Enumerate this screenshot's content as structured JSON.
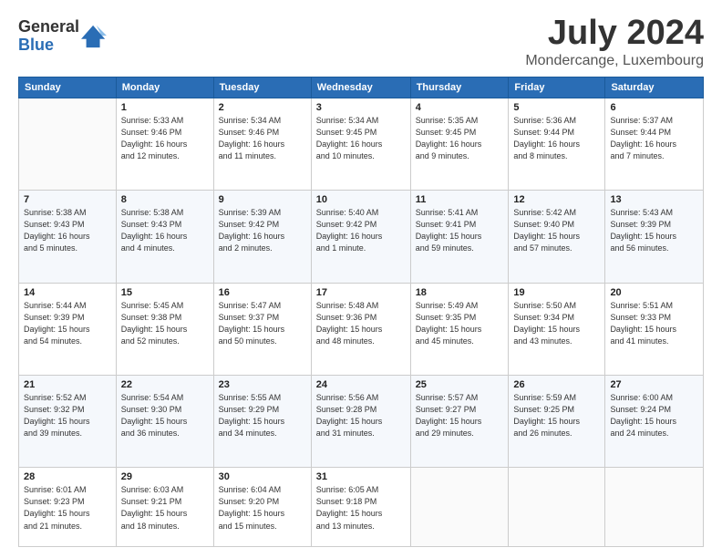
{
  "header": {
    "logo_line1": "General",
    "logo_line2": "Blue",
    "month": "July 2024",
    "location": "Mondercange, Luxembourg"
  },
  "weekdays": [
    "Sunday",
    "Monday",
    "Tuesday",
    "Wednesday",
    "Thursday",
    "Friday",
    "Saturday"
  ],
  "weeks": [
    [
      {
        "day": "",
        "info": ""
      },
      {
        "day": "1",
        "info": "Sunrise: 5:33 AM\nSunset: 9:46 PM\nDaylight: 16 hours\nand 12 minutes."
      },
      {
        "day": "2",
        "info": "Sunrise: 5:34 AM\nSunset: 9:46 PM\nDaylight: 16 hours\nand 11 minutes."
      },
      {
        "day": "3",
        "info": "Sunrise: 5:34 AM\nSunset: 9:45 PM\nDaylight: 16 hours\nand 10 minutes."
      },
      {
        "day": "4",
        "info": "Sunrise: 5:35 AM\nSunset: 9:45 PM\nDaylight: 16 hours\nand 9 minutes."
      },
      {
        "day": "5",
        "info": "Sunrise: 5:36 AM\nSunset: 9:44 PM\nDaylight: 16 hours\nand 8 minutes."
      },
      {
        "day": "6",
        "info": "Sunrise: 5:37 AM\nSunset: 9:44 PM\nDaylight: 16 hours\nand 7 minutes."
      }
    ],
    [
      {
        "day": "7",
        "info": "Sunrise: 5:38 AM\nSunset: 9:43 PM\nDaylight: 16 hours\nand 5 minutes."
      },
      {
        "day": "8",
        "info": "Sunrise: 5:38 AM\nSunset: 9:43 PM\nDaylight: 16 hours\nand 4 minutes."
      },
      {
        "day": "9",
        "info": "Sunrise: 5:39 AM\nSunset: 9:42 PM\nDaylight: 16 hours\nand 2 minutes."
      },
      {
        "day": "10",
        "info": "Sunrise: 5:40 AM\nSunset: 9:42 PM\nDaylight: 16 hours\nand 1 minute."
      },
      {
        "day": "11",
        "info": "Sunrise: 5:41 AM\nSunset: 9:41 PM\nDaylight: 15 hours\nand 59 minutes."
      },
      {
        "day": "12",
        "info": "Sunrise: 5:42 AM\nSunset: 9:40 PM\nDaylight: 15 hours\nand 57 minutes."
      },
      {
        "day": "13",
        "info": "Sunrise: 5:43 AM\nSunset: 9:39 PM\nDaylight: 15 hours\nand 56 minutes."
      }
    ],
    [
      {
        "day": "14",
        "info": "Sunrise: 5:44 AM\nSunset: 9:39 PM\nDaylight: 15 hours\nand 54 minutes."
      },
      {
        "day": "15",
        "info": "Sunrise: 5:45 AM\nSunset: 9:38 PM\nDaylight: 15 hours\nand 52 minutes."
      },
      {
        "day": "16",
        "info": "Sunrise: 5:47 AM\nSunset: 9:37 PM\nDaylight: 15 hours\nand 50 minutes."
      },
      {
        "day": "17",
        "info": "Sunrise: 5:48 AM\nSunset: 9:36 PM\nDaylight: 15 hours\nand 48 minutes."
      },
      {
        "day": "18",
        "info": "Sunrise: 5:49 AM\nSunset: 9:35 PM\nDaylight: 15 hours\nand 45 minutes."
      },
      {
        "day": "19",
        "info": "Sunrise: 5:50 AM\nSunset: 9:34 PM\nDaylight: 15 hours\nand 43 minutes."
      },
      {
        "day": "20",
        "info": "Sunrise: 5:51 AM\nSunset: 9:33 PM\nDaylight: 15 hours\nand 41 minutes."
      }
    ],
    [
      {
        "day": "21",
        "info": "Sunrise: 5:52 AM\nSunset: 9:32 PM\nDaylight: 15 hours\nand 39 minutes."
      },
      {
        "day": "22",
        "info": "Sunrise: 5:54 AM\nSunset: 9:30 PM\nDaylight: 15 hours\nand 36 minutes."
      },
      {
        "day": "23",
        "info": "Sunrise: 5:55 AM\nSunset: 9:29 PM\nDaylight: 15 hours\nand 34 minutes."
      },
      {
        "day": "24",
        "info": "Sunrise: 5:56 AM\nSunset: 9:28 PM\nDaylight: 15 hours\nand 31 minutes."
      },
      {
        "day": "25",
        "info": "Sunrise: 5:57 AM\nSunset: 9:27 PM\nDaylight: 15 hours\nand 29 minutes."
      },
      {
        "day": "26",
        "info": "Sunrise: 5:59 AM\nSunset: 9:25 PM\nDaylight: 15 hours\nand 26 minutes."
      },
      {
        "day": "27",
        "info": "Sunrise: 6:00 AM\nSunset: 9:24 PM\nDaylight: 15 hours\nand 24 minutes."
      }
    ],
    [
      {
        "day": "28",
        "info": "Sunrise: 6:01 AM\nSunset: 9:23 PM\nDaylight: 15 hours\nand 21 minutes."
      },
      {
        "day": "29",
        "info": "Sunrise: 6:03 AM\nSunset: 9:21 PM\nDaylight: 15 hours\nand 18 minutes."
      },
      {
        "day": "30",
        "info": "Sunrise: 6:04 AM\nSunset: 9:20 PM\nDaylight: 15 hours\nand 15 minutes."
      },
      {
        "day": "31",
        "info": "Sunrise: 6:05 AM\nSunset: 9:18 PM\nDaylight: 15 hours\nand 13 minutes."
      },
      {
        "day": "",
        "info": ""
      },
      {
        "day": "",
        "info": ""
      },
      {
        "day": "",
        "info": ""
      }
    ]
  ]
}
